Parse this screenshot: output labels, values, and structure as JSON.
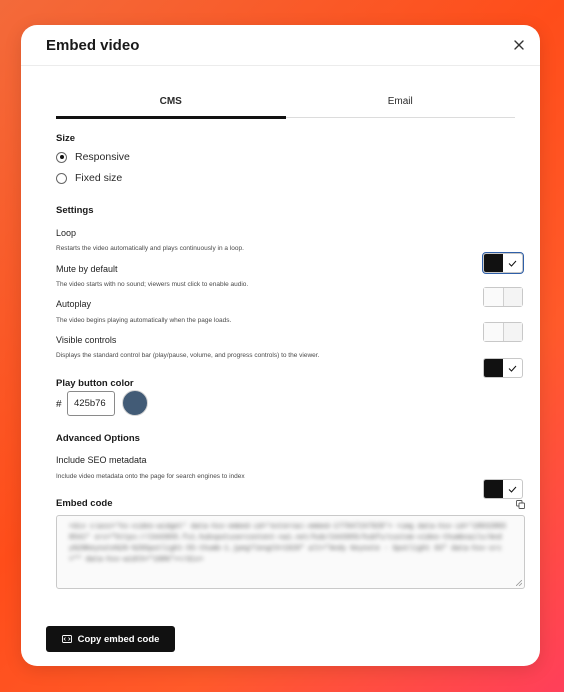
{
  "modal": {
    "title": "Embed video",
    "close_icon": "close-icon"
  },
  "tabs": [
    {
      "label": "CMS",
      "active": true
    },
    {
      "label": "Email",
      "active": false
    }
  ],
  "size": {
    "label": "Size",
    "options": [
      {
        "label": "Responsive",
        "checked": true
      },
      {
        "label": "Fixed size",
        "checked": false
      }
    ]
  },
  "settings": {
    "label": "Settings",
    "items": [
      {
        "title": "Loop",
        "description": "Restarts the video automatically and plays continuously in a loop.",
        "on": true
      },
      {
        "title": "Mute by default",
        "description": "The video starts with no sound; viewers must click to enable audio.",
        "on": false
      },
      {
        "title": "Autoplay",
        "description": "The video begins playing automatically when the page loads.",
        "on": false
      },
      {
        "title": "Visible controls",
        "description": "Displays the standard control bar (play/pause, volume, and progress controls) to the viewer.",
        "on": true
      }
    ]
  },
  "play_button_color": {
    "label": "Play button color",
    "hash": "#",
    "value": "425b76",
    "swatch_color": "#425b76"
  },
  "advanced": {
    "label": "Advanced Options",
    "items": [
      {
        "title": "Include SEO metadata",
        "description": "Include video metadata onto the page for search engines to index",
        "on": true
      }
    ]
  },
  "embed_code": {
    "label": "Embed code",
    "copy_icon": "copy-icon",
    "code": "<div class=\"hs-video-widget\" data-hsv-embed-id=\"external-embed-177947247928\"> <img data-hsv-id=\"189328838541\" src=\"https://2443955.fs1.hubspotusercontent-na1.net/hub/2443955/hubfs/custom-video-thumbnails/Andy%20Keynote%20-%20Spotlight-55-thumb-1.jpeg?length=1920\" alt=\"Andy Keynote - Spotlight 03\" data-hsv-src=\"\" data-hsv-width=\"100%\"></div>"
  },
  "footer": {
    "copy_button_label": "Copy embed code",
    "copy_button_icon": "code-icon"
  },
  "colors": {
    "accent": "#111111",
    "focus_outline": "#2f5fa8",
    "swatch": "#425b76"
  }
}
